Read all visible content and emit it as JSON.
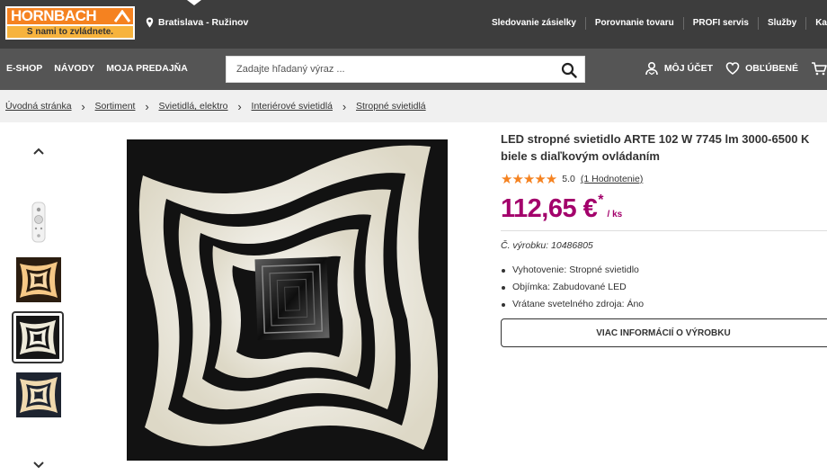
{
  "header": {
    "logo": {
      "brand": "HORNBACH",
      "slogan": "S nami to zvládnete.",
      "colors": {
        "orange": "#f58220",
        "yellow": "#f7b33d"
      }
    },
    "location": {
      "icon": "location-pin-icon",
      "text": "Bratislava - Ružinov"
    },
    "top_links": [
      "Sledovanie zásielky",
      "Porovnanie tovaru",
      "PROFI servis",
      "Služby",
      "Ka"
    ]
  },
  "nav": {
    "menu": [
      "E-SHOP",
      "NÁVODY",
      "MOJA PREDAJŇA"
    ],
    "search": {
      "placeholder": "Zadajte hľadaný výraz ...",
      "icon": "search-icon"
    },
    "account": {
      "label": "MÔJ ÚČET",
      "icon": "user-icon"
    },
    "favorites": {
      "label": "OBĽÚBENÉ",
      "icon": "heart-icon"
    },
    "cart": {
      "icon": "cart-icon"
    }
  },
  "breadcrumb": [
    "Úvodná stránka",
    "Sortiment",
    "Svietidlá, elektro",
    "Interiérové svietidlá",
    "Stropné svietidlá"
  ],
  "gallery": {
    "up_icon": "chevron-up-icon",
    "down_icon": "chevron-down-icon",
    "thumbnails": [
      "remote-control",
      "lamp-warm-light",
      "lamp-neutral-light",
      "lamp-cool-light"
    ],
    "active_thumbnail_index": 2
  },
  "product": {
    "title": "LED stropné svietidlo ARTE 102 W 7745 lm 3000-6500 K biele s diaľkovým ovládaním",
    "rating": {
      "stars": "★★★★★",
      "value": "5.0",
      "count_label": "(1 Hodnotenie)"
    },
    "price": {
      "amount": "112,65 €",
      "asterisk": "*",
      "unit": "/ ks",
      "color": "#a3006b"
    },
    "sku": {
      "label": "Č. výrobku:",
      "value": "10486805"
    },
    "features": [
      "Vyhotovenie: Stropné svietidlo",
      "Objímka: Zabudované LED",
      "Vrátane svetelného zdroja: Áno"
    ],
    "more_button": "VIAC INFORMÁCIÍ O VÝROBKU"
  }
}
